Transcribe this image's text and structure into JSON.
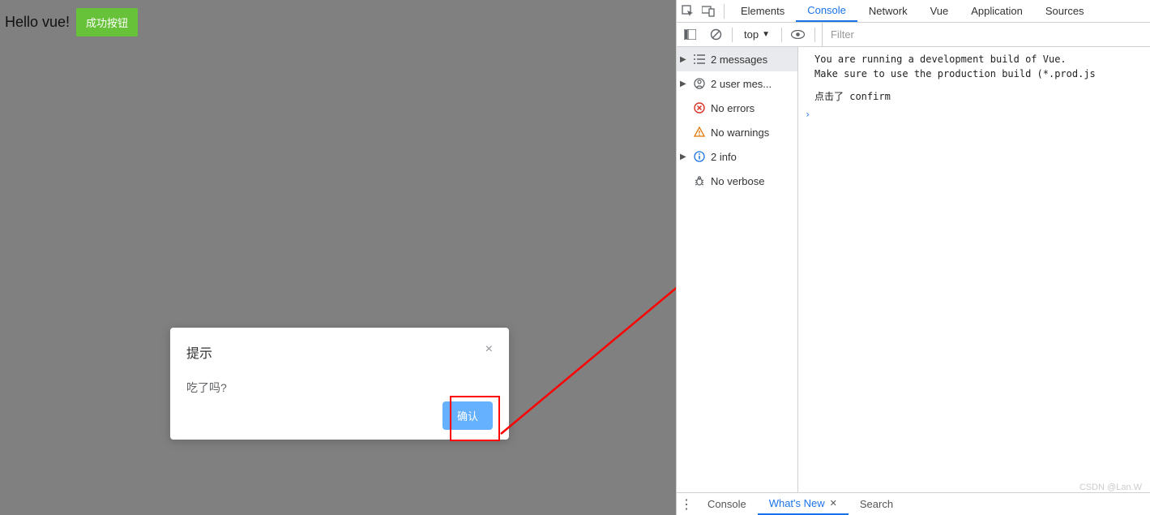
{
  "app": {
    "hello": "Hello vue!",
    "success_button": "成功按钮"
  },
  "modal": {
    "title": "提示",
    "body": "吃了吗?",
    "confirm": "确认"
  },
  "devtools": {
    "tabs": {
      "elements": "Elements",
      "console": "Console",
      "network": "Network",
      "vue": "Vue",
      "application": "Application",
      "sources": "Sources"
    },
    "toolbar": {
      "scope": "top",
      "filter_placeholder": "Filter"
    },
    "sidebar": {
      "messages": "2 messages",
      "user": "2 user mes...",
      "errors": "No errors",
      "warnings": "No warnings",
      "info": "2 info",
      "verbose": "No verbose"
    },
    "console": {
      "line1": "You are running a development build of Vue.",
      "line2": "Make sure to use the production build (*.prod.js",
      "line3": "点击了 confirm"
    },
    "drawer": {
      "console": "Console",
      "whatsnew": "What's New",
      "search": "Search"
    }
  },
  "watermark": "CSDN @Lan.W"
}
